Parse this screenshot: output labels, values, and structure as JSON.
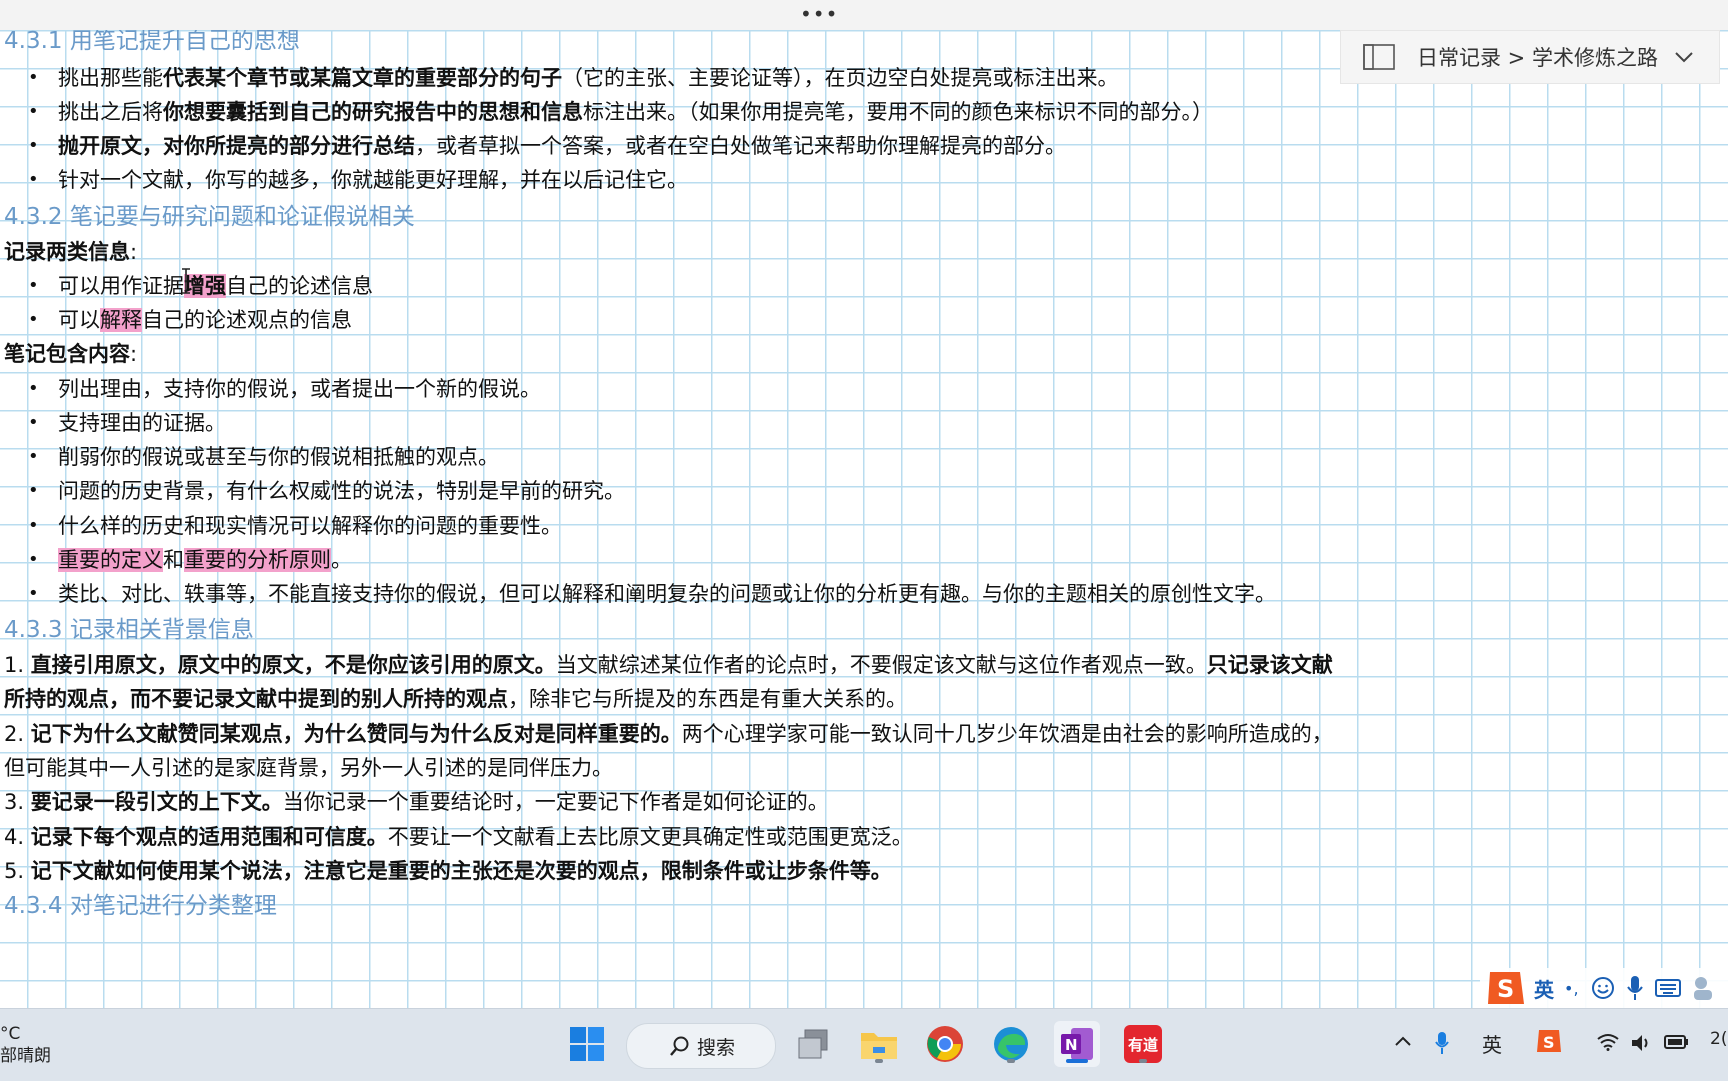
{
  "window": {
    "more_menu": "•••"
  },
  "breadcrumb": {
    "text": "日常记录 > 学术修炼之路",
    "icon": "notebook-icon"
  },
  "section_1": {
    "heading": "4.3.1 用笔记提升自己的思想",
    "bullets": [
      {
        "a": "挑出那些能",
        "b": "代表某个章节或某篇文章的重要部分的句子",
        "c": "（它的主张、主要论证等），在页边空白处提亮或标注出来。"
      },
      {
        "a": "挑出之后将",
        "b": "你想要囊括到自己的研究报告中的思想和信息",
        "c": "标注出来。（如果你用提亮笔，要用不同的颜色来标识不同的部分。）"
      },
      {
        "a": "",
        "b": "抛开原文，对你所提亮的部分进行总结",
        "c": "，或者草拟一个答案，或者在空白处做笔记来帮助你理解提亮的部分。"
      },
      {
        "a": "针对一个文献，你写的越多，你就越能更好理解，并在以后记住它。",
        "b": "",
        "c": ""
      }
    ]
  },
  "section_2": {
    "heading": "4.3.2 笔记要与研究问题和论证假说相关",
    "label_1": "记录两类信息",
    "colon": ":",
    "info_bullets": [
      {
        "a": "可以用作证据",
        "hl": "增强",
        "c": "自己的论述信息"
      },
      {
        "a": "可以",
        "hl": "解释",
        "c": "自己的论述观点的信息"
      }
    ],
    "label_2": "笔记包含内容",
    "content_bullets": [
      "列出理由，支持你的假说，或者提出一个新的假说。",
      "支持理由的证据。",
      "削弱你的假说或甚至与你的假说相抵触的观点。",
      "问题的历史背景，有什么权威性的说法，特别是早前的研究。",
      "什么样的历史和现实情况可以解释你的问题的重要性。"
    ],
    "highlight_bullet": {
      "hl1": "重要的定义",
      "mid": "和",
      "hl2": "重要的分析原则",
      "end": "。"
    },
    "last_bullet": "类比、对比、轶事等，不能直接支持你的假说，但可以解释和阐明复杂的问题或让你的分析更有趣。与你的主题相关的原创性文字。"
  },
  "section_3": {
    "heading": "4.3.3 记录相关背景信息",
    "items": [
      {
        "n": "1. ",
        "b1": "直接引用原文，原文中的原文，不是你应该引用的原文。",
        "t1": "当文献综述某位作者的论点时，不要假定该文献与这位作者观点一致。",
        "b2": "只记录该文献",
        "b3": "所持的观点，而不要记录文献中提到的别人所持的观点",
        "t2": "，除非它与所提及的东西是有重大关系的。"
      },
      {
        "n": "2. ",
        "b1": "记下为什么文献赞同某观点，为什么赞同与为什么反对是同样重要的。",
        "t1": "两个心理学家可能一致认同十几岁少年饮酒是由社会的影响所造成的，",
        "t2": "但可能其中一人引述的是家庭背景，另外一人引述的是同伴压力。"
      },
      {
        "n": "3. ",
        "b1": "要记录一段引文的上下文。",
        "t1": "当你记录一个重要结论时，一定要记下作者是如何论证的。"
      },
      {
        "n": "4. ",
        "b1": "记录下每个观点的适用范围和可信度。",
        "t1": "不要让一个文献看上去比原文更具确定性或范围更宽泛。"
      },
      {
        "n": "5. ",
        "b1": "记下文献如何使用某个说法，注意它是重要的主张还是次要的观点，限制条件或让步条件等。",
        "t1": ""
      }
    ]
  },
  "section_4": {
    "heading": "4.3.4 对笔记进行分类整理"
  },
  "ime": {
    "lang": "英",
    "punct": "•,",
    "icons": [
      "sogou-logo-icon",
      "emoji-icon",
      "microphone-icon",
      "keyboard-icon",
      "skin-icon"
    ]
  },
  "taskbar": {
    "weather_temp": "°C",
    "weather_desc": "部晴朗",
    "search_label": "搜索",
    "apps": [
      "windows-start-icon",
      "search-icon",
      "task-view-icon",
      "file-explorer-icon",
      "chrome-icon",
      "edge-icon",
      "onenote-icon",
      "youdao-icon"
    ],
    "youdao_label": "有道",
    "tray_lang": "英",
    "clock_fragment": "2(",
    "accent": "#1a6fd8",
    "highlight_color": "#f3a1cb",
    "heading_color": "#6a9ac9"
  }
}
